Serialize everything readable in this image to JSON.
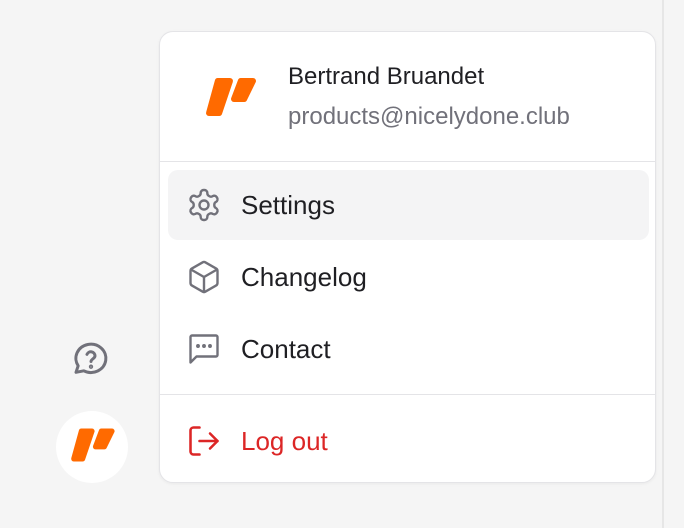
{
  "user": {
    "name": "Bertrand Bruandet",
    "email": "products@nicelydone.club",
    "avatar_icon": "brand-logo-icon"
  },
  "menu": {
    "items": [
      {
        "label": "Settings",
        "icon": "gear-icon",
        "active": true
      },
      {
        "label": "Changelog",
        "icon": "cube-icon",
        "active": false
      },
      {
        "label": "Contact",
        "icon": "chat-dots-icon",
        "active": false
      }
    ],
    "logout": {
      "label": "Log out",
      "icon": "logout-icon"
    }
  },
  "sidebar": {
    "help_icon": "help-chat-icon",
    "avatar_icon": "brand-logo-icon"
  },
  "colors": {
    "brand": "#ff6a00",
    "danger": "#dc2626",
    "icon_gray": "#71717a",
    "hover_bg": "#f4f4f5"
  }
}
